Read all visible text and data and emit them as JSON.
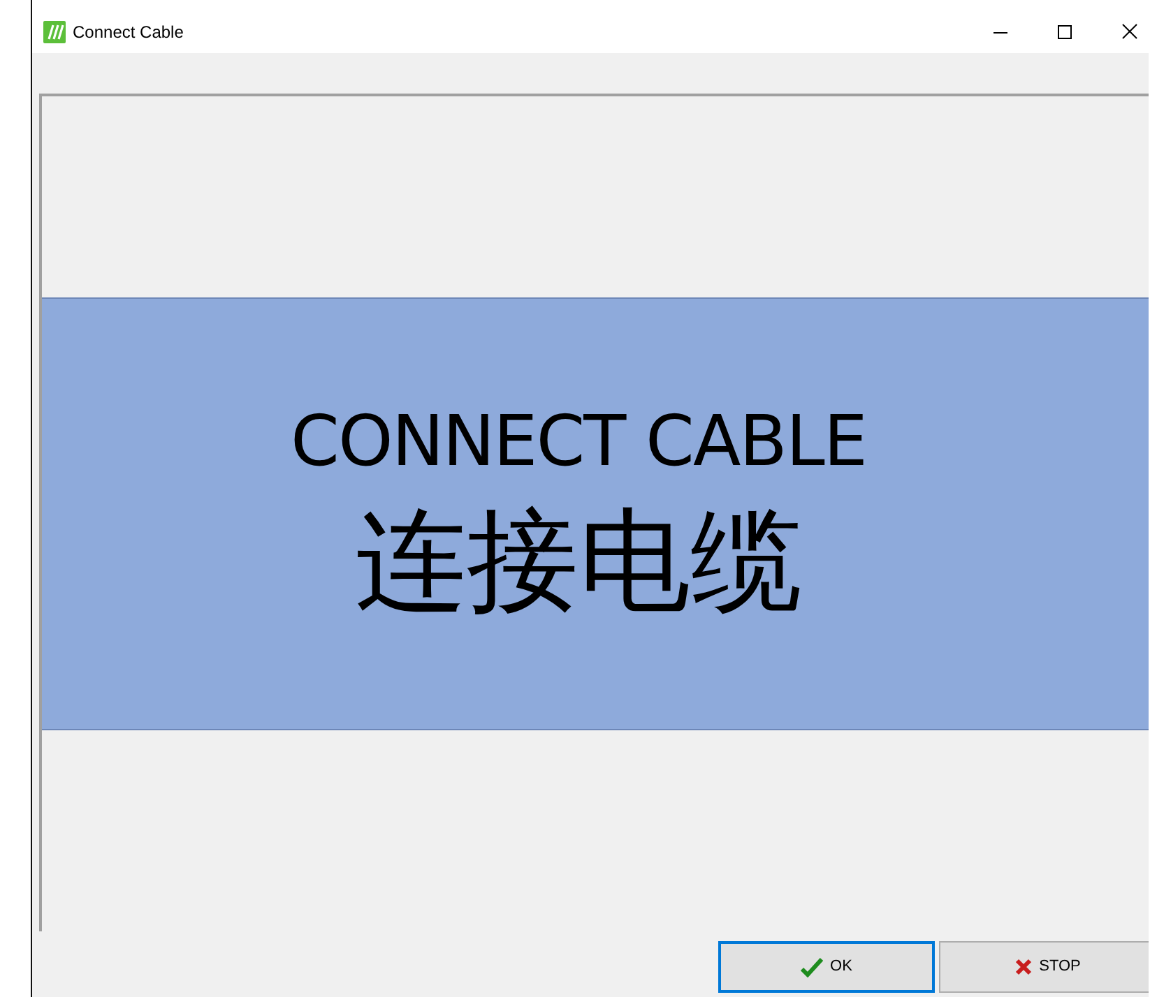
{
  "window": {
    "title": "Connect Cable"
  },
  "message": {
    "lines": [
      {
        "text": "CONNECT CABLE",
        "kind": "latin"
      },
      {
        "text": "连接电缆",
        "kind": "cjk"
      }
    ]
  },
  "buttons": [
    {
      "label": "OK",
      "kind": "ok",
      "focused": true
    },
    {
      "label": "STOP",
      "kind": "stop",
      "focused": false
    }
  ]
}
